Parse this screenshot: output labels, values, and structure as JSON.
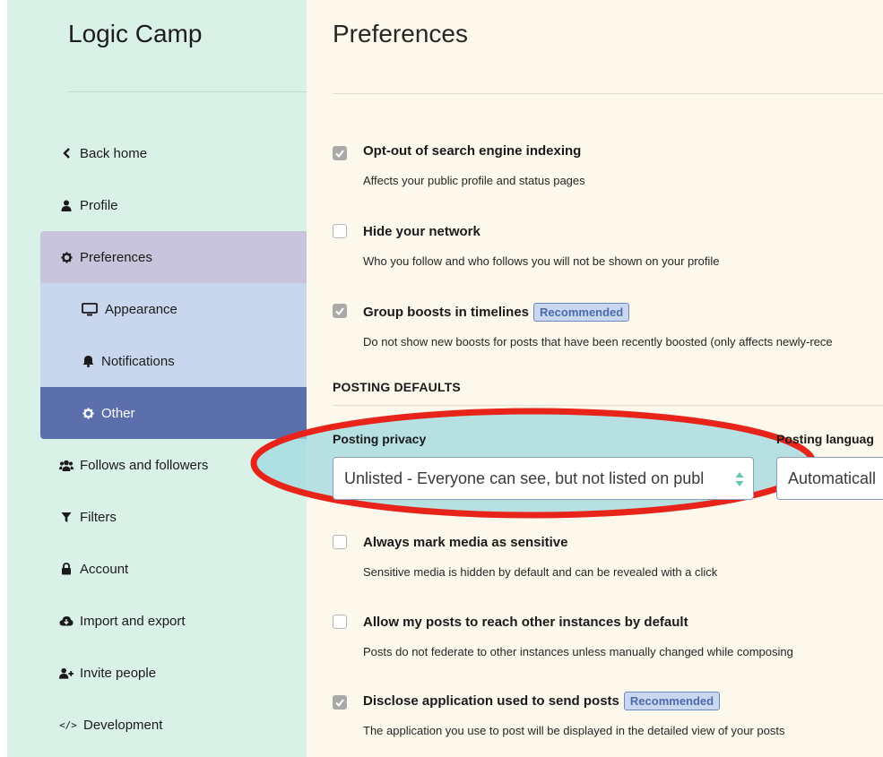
{
  "sidebar": {
    "brand": "Logic Camp",
    "items": [
      {
        "label": "Back home",
        "icon": "chevron-left-icon"
      },
      {
        "label": "Profile",
        "icon": "user-icon"
      },
      {
        "label": "Preferences",
        "icon": "gear-icon"
      },
      {
        "label": "Appearance",
        "icon": "desktop-icon"
      },
      {
        "label": "Notifications",
        "icon": "bell-icon"
      },
      {
        "label": "Other",
        "icon": "gear-icon"
      },
      {
        "label": "Follows and followers",
        "icon": "users-icon"
      },
      {
        "label": "Filters",
        "icon": "filter-icon"
      },
      {
        "label": "Account",
        "icon": "lock-icon"
      },
      {
        "label": "Import and export",
        "icon": "cloud-icon"
      },
      {
        "label": "Invite people",
        "icon": "user-plus-icon"
      },
      {
        "label": "Development",
        "icon": "code-icon"
      }
    ]
  },
  "main": {
    "title": "Preferences",
    "options": [
      {
        "title": "Opt-out of search engine indexing",
        "desc": "Affects your public profile and status pages",
        "checked": true
      },
      {
        "title": "Hide your network",
        "desc": "Who you follow and who follows you will not be shown on your profile",
        "checked": false
      },
      {
        "title": "Group boosts in timelines",
        "badge": "Recommended",
        "desc": "Do not show new boosts for posts that have been recently boosted (only affects newly-rece",
        "checked": true
      }
    ],
    "section_heading": "POSTING DEFAULTS",
    "posting_privacy": {
      "label": "Posting privacy",
      "value": "Unlisted - Everyone can see, but not listed on publ"
    },
    "posting_language": {
      "label": "Posting languag",
      "value": "Automaticall"
    },
    "options2": [
      {
        "title": "Always mark media as sensitive",
        "desc": "Sensitive media is hidden by default and can be revealed with a click",
        "checked": false
      },
      {
        "title": "Allow my posts to reach other instances by default",
        "desc": "Posts do not federate to other instances unless manually changed while composing",
        "checked": false
      },
      {
        "title": "Disclose application used to send posts",
        "badge": "Recommended",
        "desc": "The application you use to post will be displayed in the detailed view of your posts",
        "checked": true
      }
    ]
  },
  "colors": {
    "sidebar_bg": "#daf1e7",
    "main_bg": "#fdf8ec",
    "active_nav": "#5a6fac",
    "highlight_fill": "#9fd8df",
    "highlight_stroke": "#e8241a"
  }
}
